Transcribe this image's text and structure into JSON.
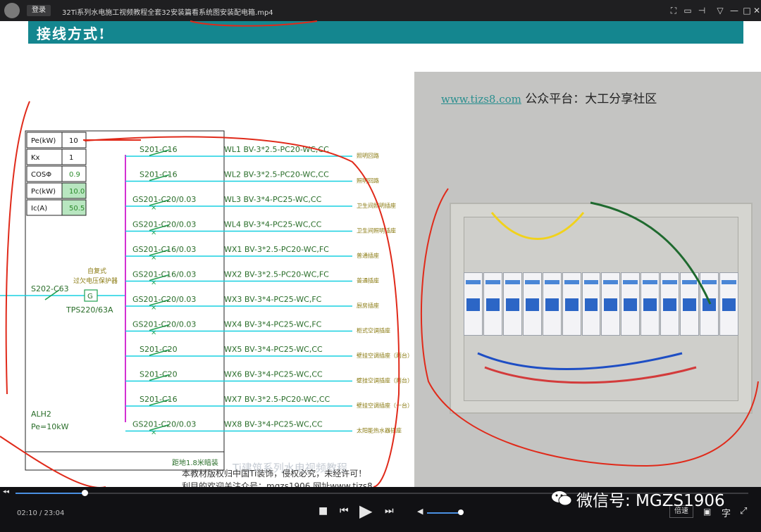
{
  "player": {
    "login": "登录",
    "title": "32Ti系列水电施工视频教程全套32安装篇看系统图安装配电箱.mp4",
    "time": "02:10 / 23:04",
    "speed": "倍速",
    "subtitle_btn": "字",
    "progress": 0.094,
    "volume": 0.85
  },
  "slide": {
    "title": "接线方式!",
    "photo_watermark": "www.tizs8.com",
    "photo_label": "公众平台：大工分享社区",
    "watermark_center": "Ti建筑系列水电视频教程",
    "caption_line1": "本教材版权归中国Ti装饰，侵权必究，未经许可！",
    "caption_line2": "利目的欢迎关注众号：mgzs1906  网址www.tizs8"
  },
  "table": [
    {
      "k": "Pe(kW)",
      "v": "10"
    },
    {
      "k": "Kx",
      "v": "1"
    },
    {
      "k": "COSΦ",
      "v": "0.9"
    },
    {
      "k": "Pc(kW)",
      "v": "10.0"
    },
    {
      "k": "Ic(A)",
      "v": "50.5"
    }
  ],
  "diagram": {
    "incoming_breaker": "S202-C63",
    "protector_label": "自复式\n过欠电压保护器",
    "protector_model": "TPS220/63A",
    "g_label": "G",
    "box_name": "ALH2",
    "box_power": "Pe=10kW",
    "footer_note": "距地1.8米暗装",
    "circuits": [
      {
        "breaker": "S201-C16",
        "line": "WL1  BV-3*2.5-PC20-WC,CC",
        "load": "照明回路"
      },
      {
        "breaker": "S201-C16",
        "line": "WL2  BV-3*2.5-PC20-WC,CC",
        "load": "照明回路"
      },
      {
        "breaker": "GS201-C20/0.03",
        "line": "WL3  BV-3*4-PC25-WC,CC",
        "load": "卫生间照明插座"
      },
      {
        "breaker": "GS201-C20/0.03",
        "line": "WL4  BV-3*4-PC25-WC,CC",
        "load": "卫生间照明插座"
      },
      {
        "breaker": "GS201-C16/0.03",
        "line": "WX1  BV-3*2.5-PC20-WC,FC",
        "load": "普通插座"
      },
      {
        "breaker": "GS201-C16/0.03",
        "line": "WX2  BV-3*2.5-PC20-WC,FC",
        "load": "普通插座"
      },
      {
        "breaker": "GS201-C20/0.03",
        "line": "WX3  BV-3*4-PC25-WC,FC",
        "load": "厨房插座"
      },
      {
        "breaker": "GS201-C20/0.03",
        "line": "WX4  BV-3*4-PC25-WC,FC",
        "load": "柜式空调插座"
      },
      {
        "breaker": "S201-C20",
        "line": "WX5  BV-3*4-PC25-WC,CC",
        "load": "壁挂空调插座（两台）"
      },
      {
        "breaker": "S201-C20",
        "line": "WX6  BV-3*4-PC25-WC,CC",
        "load": "壁挂空调插座（两台）"
      },
      {
        "breaker": "S201-C16",
        "line": "WX7  BV-3*2.5-PC20-WC,CC",
        "load": "壁挂空调插座（一台）"
      },
      {
        "breaker": "GS201-C20/0.03",
        "line": "WX8  BV-3*4-PC25-WC,CC",
        "load": "太阳能热水器插座"
      }
    ]
  },
  "overlay": {
    "wechat_text": "微信号: MGZS1906"
  },
  "colors": {
    "banner": "#14868f",
    "line": "#18d0e0",
    "bus": "#d32fd3",
    "switch": "#20a050",
    "text": "#2a6e2a",
    "load": "#c8b820",
    "annotation": "#e02a1a"
  }
}
